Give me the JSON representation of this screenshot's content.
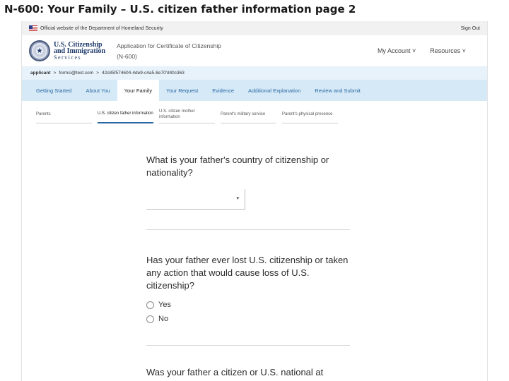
{
  "slide_title": "N-600: Your Family – U.S. citizen father information page 2",
  "gov_banner": {
    "text": "Official website of the Department of Homeland Security",
    "sign_out": "Sign Out"
  },
  "header": {
    "agency_line1": "U.S. Citizenship",
    "agency_line2": "and Immigration",
    "agency_line3": "Services",
    "app_title": "Application for Certificate of Citizenship",
    "app_code": "(N-600)",
    "my_account": "My Account ˅",
    "resources": "Resources ˅"
  },
  "breadcrumb": {
    "role": "applicant",
    "email": "formsi@test.com",
    "case_id": "42c85f574604-4de9-c4a5-8e70'd40c363",
    "separator": ">"
  },
  "main_tabs": [
    {
      "label": "Getting Started"
    },
    {
      "label": "About You"
    },
    {
      "label": "Your Family"
    },
    {
      "label": "Your Request"
    },
    {
      "label": "Evidence"
    },
    {
      "label": "Additional Explanation"
    },
    {
      "label": "Review and Submit"
    }
  ],
  "active_main_tab": "Your Family",
  "sub_tabs": [
    {
      "label": "Parents"
    },
    {
      "label": "U.S. citizen father information"
    },
    {
      "label": "U.S. citizen mother information"
    },
    {
      "label": "Parent's military service"
    },
    {
      "label": "Parent's physical presence"
    }
  ],
  "active_sub_tab": "U.S. citizen father information",
  "form": {
    "q1": "What is your father's country of citizenship or nationality?",
    "q1_select_value": "",
    "q2": "Has your father ever lost U.S. citizenship or taken any action that would cause loss of U.S. citizenship?",
    "q2_options": [
      "Yes",
      "No"
    ],
    "q3_partial": "Was your father a citizen or U.S. national at"
  },
  "icons": {
    "dropdown_caret": "▾"
  }
}
